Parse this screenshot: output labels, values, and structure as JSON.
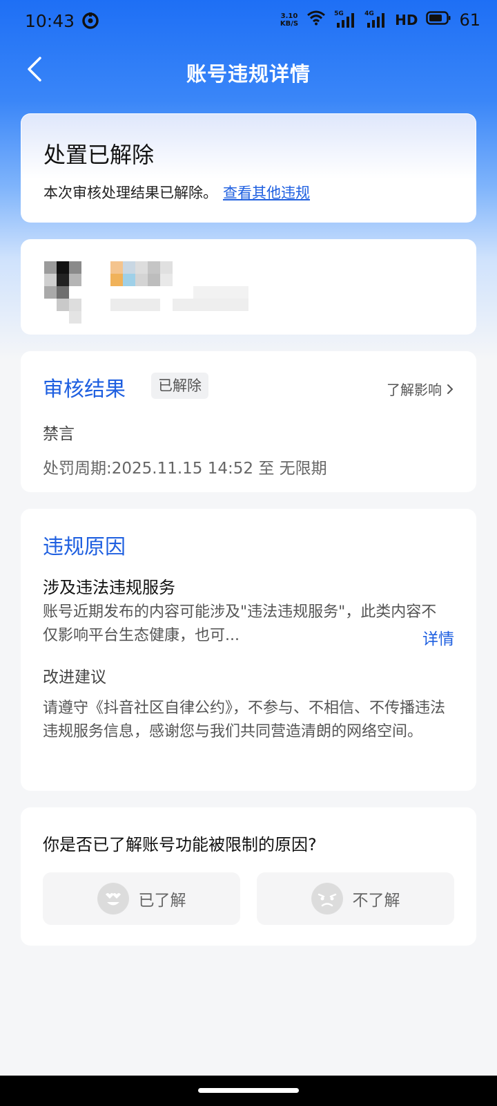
{
  "status_bar": {
    "time": "10:43",
    "net_speed_value": "3.10",
    "net_speed_unit": "KB/S",
    "network_5g": "5G",
    "network_4g": "4G",
    "hd": "HD",
    "battery": "61"
  },
  "nav": {
    "title": "账号违规详情",
    "back_icon": "chevron-left-icon"
  },
  "status_card": {
    "title": "处置已解除",
    "desc": "本次审核处理结果已解除。",
    "link": "查看其他违规"
  },
  "result": {
    "title": "审核结果",
    "badge": "已解除",
    "impact_link": "了解影响",
    "type": "禁言",
    "period": "处罚周期:2025.11.15 14:52 至 无限期"
  },
  "reason": {
    "title": "违规原因",
    "subtitle": "涉及违法违规服务",
    "desc": "账号近期发布的内容可能涉及\"违法违规服务\"，此类内容不仅影响平台生态健康，也可...",
    "detail_link": "详情",
    "suggest_title": "改进建议",
    "suggest_text": "请遵守《抖音社区自律公约》，不参与、不相信、不传播违法违规服务信息，感谢您与我们共同营造清朗的网络空间。"
  },
  "feedback": {
    "question": "你是否已了解账号功能被限制的原因?",
    "yes_label": "已了解",
    "no_label": "不了解"
  },
  "colors": {
    "accent": "#1e5fe0",
    "header_blue": "#1e6ff5"
  }
}
